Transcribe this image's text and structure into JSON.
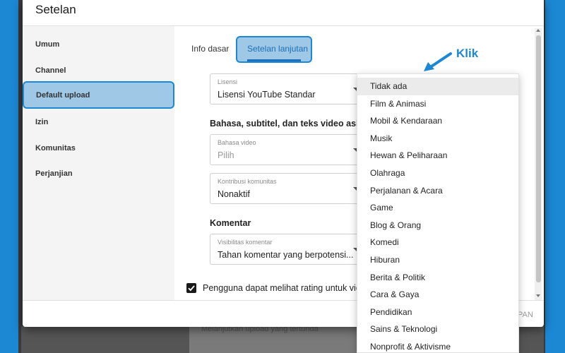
{
  "dialog": {
    "title": "Setelan",
    "save_label": "PAN"
  },
  "sidebar": {
    "items": [
      {
        "label": "Umum"
      },
      {
        "label": "Channel"
      },
      {
        "label": "Default upload"
      },
      {
        "label": "Izin"
      },
      {
        "label": "Komunitas"
      },
      {
        "label": "Perjanjian"
      }
    ],
    "selected": "Default upload"
  },
  "tabs": [
    {
      "label": "Info dasar"
    },
    {
      "label": "Setelan lanjutan"
    }
  ],
  "active_tab": "Setelan lanjutan",
  "fields": {
    "lisensi": {
      "label": "Lisensi",
      "value": "Lisensi YouTube Standar"
    },
    "bahasa": {
      "label": "Bahasa video",
      "value": "Pilih"
    },
    "kontribusi": {
      "label": "Kontribusi komunitas",
      "value": "Nonaktif"
    },
    "visibilitas": {
      "label": "Visibilitas komentar",
      "value": "Tahan komentar yang berpotensi..."
    }
  },
  "sections": {
    "language": "Bahasa, subtitel, dan teks video asli",
    "comments": "Komentar"
  },
  "rating_checkbox": {
    "label": "Pengguna dapat melihat rating untuk video",
    "checked": true
  },
  "category_dropdown": {
    "highlighted": "Tidak ada",
    "options": [
      "Tidak ada",
      "Film & Animasi",
      "Mobil & Kendaraan",
      "Musik",
      "Hewan & Peliharaan",
      "Olahraga",
      "Perjalanan & Acara",
      "Game",
      "Blog & Orang",
      "Komedi",
      "Hiburan",
      "Berita & Politik",
      "Cara & Gaya",
      "Pendidikan",
      "Sains & Teknologi",
      "Nonprofit & Aktivisme"
    ]
  },
  "annotation": {
    "text": "Klik",
    "color": "#1c88d4"
  },
  "background": {
    "bottom_text": "Melanjutkan upload yang tertunda"
  },
  "colors": {
    "accent": "#1c6fb8",
    "highlight_fill": "#9ec8e6",
    "highlight_border": "#1c88d4"
  }
}
